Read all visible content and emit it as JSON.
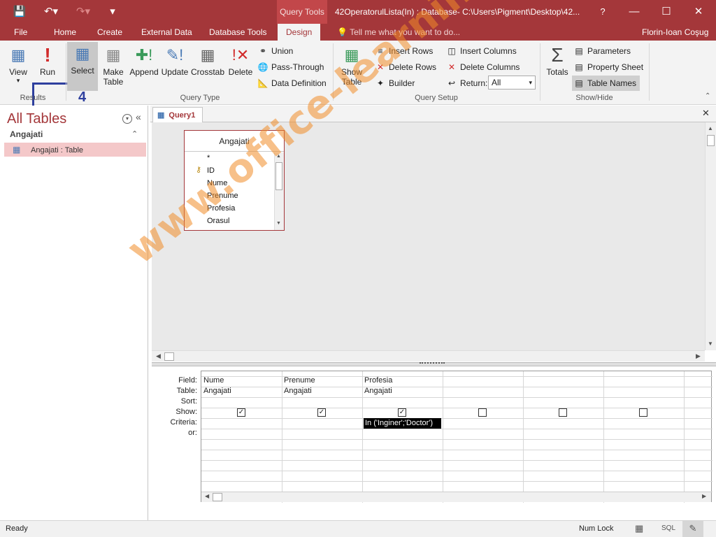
{
  "titlebar": {
    "context_tab": "Query Tools",
    "doc_title": "42OperatorulLista(In) : Database- C:\\Users\\Pigment\\Desktop\\42...",
    "help": "?"
  },
  "tabs": {
    "file": "File",
    "home": "Home",
    "create": "Create",
    "external": "External Data",
    "dbtools": "Database Tools",
    "design": "Design",
    "tellme": "Tell me what you want to do...",
    "user": "Florin-Ioan Coşug"
  },
  "ribbon": {
    "view": "View",
    "run": "Run",
    "select": "Select",
    "make_table_1": "Make",
    "make_table_2": "Table",
    "append": "Append",
    "update": "Update",
    "crosstab": "Crosstab",
    "delete": "Delete",
    "union": "Union",
    "passthrough": "Pass-Through",
    "datadef": "Data Definition",
    "show_table_1": "Show",
    "show_table_2": "Table",
    "insert_rows": "Insert Rows",
    "delete_rows": "Delete Rows",
    "builder": "Builder",
    "insert_cols": "Insert Columns",
    "delete_cols": "Delete Columns",
    "return_label": "Return:",
    "return_value": "All",
    "totals": "Totals",
    "parameters": "Parameters",
    "property_sheet": "Property Sheet",
    "table_names": "Table Names",
    "grp_results": "Results",
    "grp_querytype": "Query Type",
    "grp_querysetup": "Query Setup",
    "grp_showhide": "Show/Hide",
    "step_number": "4"
  },
  "nav": {
    "title": "All Tables",
    "group": "Angajati",
    "item": "Angajati : Table"
  },
  "doc": {
    "tab": "Query1",
    "table_name": "Angajati",
    "fields": [
      "*",
      "ID",
      "Nume",
      "Prenume",
      "Profesia",
      "Orasul"
    ]
  },
  "grid": {
    "row_labels": [
      "Field:",
      "Table:",
      "Sort:",
      "Show:",
      "Criteria:",
      "or:"
    ],
    "columns": [
      {
        "field": "Nume",
        "table": "Angajati",
        "show": true,
        "criteria": ""
      },
      {
        "field": "Prenume",
        "table": "Angajati",
        "show": true,
        "criteria": ""
      },
      {
        "field": "Profesia",
        "table": "Angajati",
        "show": true,
        "criteria": "In ('Inginer';'Doctor')"
      },
      {
        "field": "",
        "table": "",
        "show": false,
        "criteria": ""
      },
      {
        "field": "",
        "table": "",
        "show": false,
        "criteria": ""
      },
      {
        "field": "",
        "table": "",
        "show": false,
        "criteria": ""
      }
    ]
  },
  "status": {
    "ready": "Ready",
    "numlock": "Num Lock",
    "sql": "SQL"
  },
  "watermark": "www.office-learning.ro"
}
